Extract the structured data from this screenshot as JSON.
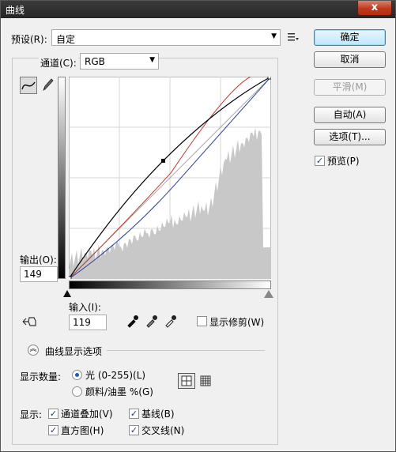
{
  "window": {
    "title": "曲线",
    "close_label": "x"
  },
  "preset": {
    "label": "预设(R):",
    "value": "自定"
  },
  "channel": {
    "label": "通道(C):",
    "value": "RGB"
  },
  "buttons": {
    "ok": "确定",
    "cancel": "取消",
    "smooth": "平滑(M)",
    "auto": "自动(A)",
    "options": "选项(T)..."
  },
  "preview": {
    "label": "预览(P)",
    "checked": true
  },
  "output": {
    "label": "输出(O):",
    "value": "149"
  },
  "input": {
    "label": "输入(I):",
    "value": "119"
  },
  "show_clipping": {
    "label": "显示修剪(W)",
    "checked": false
  },
  "curve_display": {
    "title": "曲线显示选项"
  },
  "show_amount": {
    "label": "显示数量:",
    "light": "光 (0-255)(L)",
    "pigment": "颜料/油墨 %(G)",
    "selected": "light"
  },
  "show": {
    "label": "显示:",
    "channel_overlays": "通道叠加(V)",
    "baseline": "基线(B)",
    "histogram": "直方图(H)",
    "intersection_line": "交叉线(N)"
  },
  "icons": [
    "curve-tool-icon",
    "pencil-icon",
    "preset-menu-icon",
    "target-adjust-icon",
    "black-eyedropper-icon",
    "gray-eyedropper-icon",
    "white-eyedropper-icon",
    "expand-icon",
    "grid-4-icon",
    "grid-10-icon"
  ],
  "colors": {
    "title_bar": "#2e2e2e",
    "close": "#c0391c",
    "histogram": "#c8c8c8",
    "red_curve": "#c0392b",
    "blue_curve": "#2c3e9e"
  },
  "chart_data": {
    "type": "line",
    "xlim": [
      0,
      255
    ],
    "ylim": [
      0,
      255
    ],
    "point": {
      "x": 119,
      "y": 149
    },
    "grid": "4x4"
  }
}
